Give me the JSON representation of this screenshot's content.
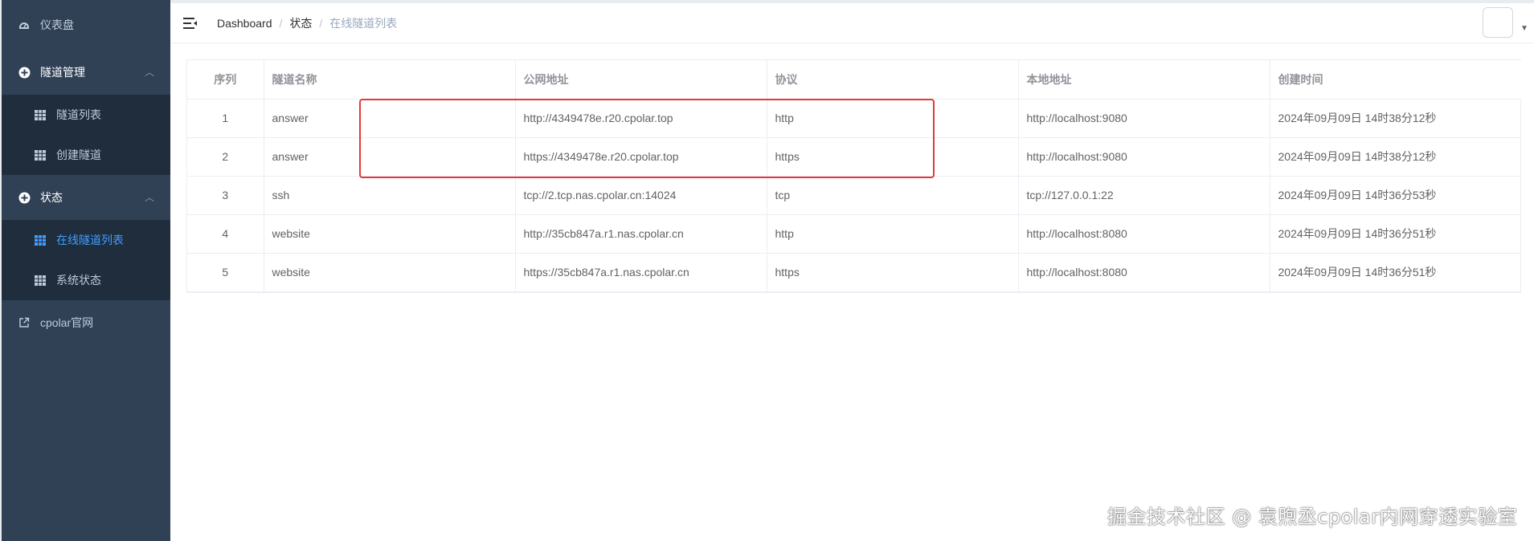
{
  "sidebar": {
    "items": [
      {
        "label": "仪表盘",
        "icon": "dashboard-icon"
      },
      {
        "label": "隧道管理",
        "icon": "plus-circle-icon",
        "children": [
          {
            "label": "隧道列表",
            "icon": "grid-icon"
          },
          {
            "label": "创建隧道",
            "icon": "grid-icon"
          }
        ]
      },
      {
        "label": "状态",
        "icon": "plus-circle-icon",
        "children": [
          {
            "label": "在线隧道列表",
            "icon": "grid-icon",
            "active": true
          },
          {
            "label": "系统状态",
            "icon": "grid-icon"
          }
        ]
      },
      {
        "label": "cpolar官网",
        "icon": "external-link-icon"
      }
    ]
  },
  "breadcrumb": [
    "Dashboard",
    "状态",
    "在线隧道列表"
  ],
  "table": {
    "headers": [
      "序列",
      "隧道名称",
      "公网地址",
      "协议",
      "本地地址",
      "创建时间"
    ],
    "rows": [
      [
        "1",
        "answer",
        "http://4349478e.r20.cpolar.top",
        "http",
        "http://localhost:9080",
        "2024年09月09日 14时38分12秒"
      ],
      [
        "2",
        "answer",
        "https://4349478e.r20.cpolar.top",
        "https",
        "http://localhost:9080",
        "2024年09月09日 14时38分12秒"
      ],
      [
        "3",
        "ssh",
        "tcp://2.tcp.nas.cpolar.cn:14024",
        "tcp",
        "tcp://127.0.0.1:22",
        "2024年09月09日 14时36分53秒"
      ],
      [
        "4",
        "website",
        "http://35cb847a.r1.nas.cpolar.cn",
        "http",
        "http://localhost:8080",
        "2024年09月09日 14时36分51秒"
      ],
      [
        "5",
        "website",
        "https://35cb847a.r1.nas.cpolar.cn",
        "https",
        "http://localhost:8080",
        "2024年09月09日 14时36分51秒"
      ]
    ]
  },
  "watermark": "掘金技术社区 @ 袁煦丞cpolar内网穿透实验室",
  "colors": {
    "sidebar_bg": "#304156",
    "submenu_bg": "#1f2d3d",
    "active": "#409eff",
    "highlight": "#e23a3a"
  }
}
